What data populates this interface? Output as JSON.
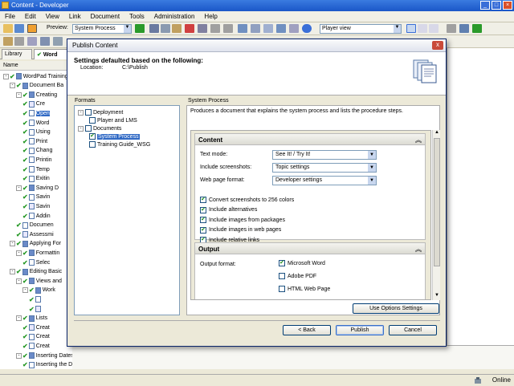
{
  "window": {
    "title": "Content - Developer"
  },
  "menu": [
    "File",
    "Edit",
    "View",
    "Link",
    "Document",
    "Tools",
    "Administration",
    "Help"
  ],
  "toolbar": {
    "preview_label": "Preview:",
    "preview_value": "System Process",
    "view_value": "Player view"
  },
  "tabs": [
    "Library",
    "Word"
  ],
  "outline": {
    "header": "Name",
    "nodes": [
      {
        "label": "WordPad Training",
        "level": 0,
        "kind": "book",
        "pm": "-"
      },
      {
        "label": "Document Ba",
        "level": 1,
        "kind": "book",
        "pm": "-"
      },
      {
        "label": "Creating",
        "level": 2,
        "kind": "book",
        "pm": "-"
      },
      {
        "label": "Cre",
        "level": 3,
        "kind": "q",
        "pm": ""
      },
      {
        "label": "Open",
        "level": 3,
        "kind": "doc",
        "pm": "",
        "selected": true
      },
      {
        "label": "Word",
        "level": 3,
        "kind": "doc",
        "pm": ""
      },
      {
        "label": "Using",
        "level": 3,
        "kind": "doc",
        "pm": ""
      },
      {
        "label": "Print",
        "level": 3,
        "kind": "doc",
        "pm": ""
      },
      {
        "label": "Chang",
        "level": 3,
        "kind": "doc",
        "pm": ""
      },
      {
        "label": "Printin",
        "level": 3,
        "kind": "doc",
        "pm": ""
      },
      {
        "label": "Temp",
        "level": 3,
        "kind": "doc",
        "pm": ""
      },
      {
        "label": "Exitin",
        "level": 3,
        "kind": "doc",
        "pm": ""
      },
      {
        "label": "Saving D",
        "level": 2,
        "kind": "book",
        "pm": "-"
      },
      {
        "label": "Savin",
        "level": 3,
        "kind": "doc",
        "pm": ""
      },
      {
        "label": "Savin",
        "level": 3,
        "kind": "q",
        "pm": ""
      },
      {
        "label": "Addin",
        "level": 3,
        "kind": "doc",
        "pm": ""
      },
      {
        "label": "Documen",
        "level": 2,
        "kind": "doc",
        "pm": ""
      },
      {
        "label": "Assessmi",
        "level": 2,
        "kind": "q",
        "pm": ""
      },
      {
        "label": "Applying For",
        "level": 1,
        "kind": "book",
        "pm": "-"
      },
      {
        "label": "Formattin",
        "level": 2,
        "kind": "book",
        "pm": "-"
      },
      {
        "label": "Selec",
        "level": 3,
        "kind": "doc",
        "pm": ""
      },
      {
        "label": "Editing Basic",
        "level": 1,
        "kind": "book",
        "pm": "-"
      },
      {
        "label": "Views and",
        "level": 2,
        "kind": "book",
        "pm": "-"
      },
      {
        "label": "Work",
        "level": 3,
        "kind": "book",
        "pm": "-"
      },
      {
        "label": "",
        "level": 4,
        "kind": "doc",
        "pm": ""
      },
      {
        "label": "",
        "level": 4,
        "kind": "q",
        "pm": ""
      },
      {
        "label": "Lists",
        "level": 2,
        "kind": "book",
        "pm": "-"
      },
      {
        "label": "Creat",
        "level": 3,
        "kind": "q",
        "pm": ""
      },
      {
        "label": "Creat",
        "level": 3,
        "kind": "doc",
        "pm": ""
      },
      {
        "label": "Creat",
        "level": 3,
        "kind": "doc",
        "pm": ""
      },
      {
        "label": "Inserting Dates and Objects",
        "level": 2,
        "kind": "book",
        "pm": "-"
      },
      {
        "label": "Inserting the Date",
        "level": 3,
        "kind": "doc",
        "pm": ""
      }
    ]
  },
  "status": {
    "online": "Online"
  },
  "dialog": {
    "title": "Publish Content",
    "close": "x",
    "header_title": "Settings defaulted based on the following:",
    "location_label": "Location:",
    "location_value": "C:\\Publish",
    "formats_label": "Formats",
    "formats": [
      {
        "label": "Deployment",
        "indent": 0,
        "pm": "-",
        "checked": false
      },
      {
        "label": "Player and LMS",
        "indent": 1,
        "pm": "",
        "checked": false
      },
      {
        "label": "Documents",
        "indent": 0,
        "pm": "-",
        "checked": false
      },
      {
        "label": "System Process",
        "indent": 1,
        "pm": "",
        "checked": true,
        "selected": true
      },
      {
        "label": "Training Guide_WSG",
        "indent": 1,
        "pm": "",
        "checked": false
      }
    ],
    "sys_label": "System Process",
    "sys_desc": "Produces a document that explains the system process and lists the procedure steps.",
    "content_section": "Content",
    "text_mode_label": "Text mode:",
    "text_mode_value": "See It! / Try It!",
    "screenshots_label": "Include screenshots:",
    "screenshots_value": "Topic settings",
    "webpage_label": "Web page format:",
    "webpage_value": "Developer settings",
    "content_checks": [
      {
        "label": "Convert screenshots to 256 colors",
        "checked": true
      },
      {
        "label": "Include alternatives",
        "checked": true
      },
      {
        "label": "Include images from packages",
        "checked": true
      },
      {
        "label": "Include images in web pages",
        "checked": true
      },
      {
        "label": "Include relative links",
        "checked": true
      }
    ],
    "output_section": "Output",
    "output_format_label": "Output format:",
    "output_checks": [
      {
        "label": "Microsoft Word",
        "checked": true
      },
      {
        "label": "Adobe PDF",
        "checked": false
      },
      {
        "label": "HTML Web Page",
        "checked": false
      }
    ],
    "use_options": "Use Options Settings",
    "back": "< Back",
    "publish": "Publish",
    "cancel": "Cancel"
  },
  "colors": {
    "titlebar": "#1a56c8",
    "selection": "#316ac5",
    "check": "#2a9a2a"
  }
}
